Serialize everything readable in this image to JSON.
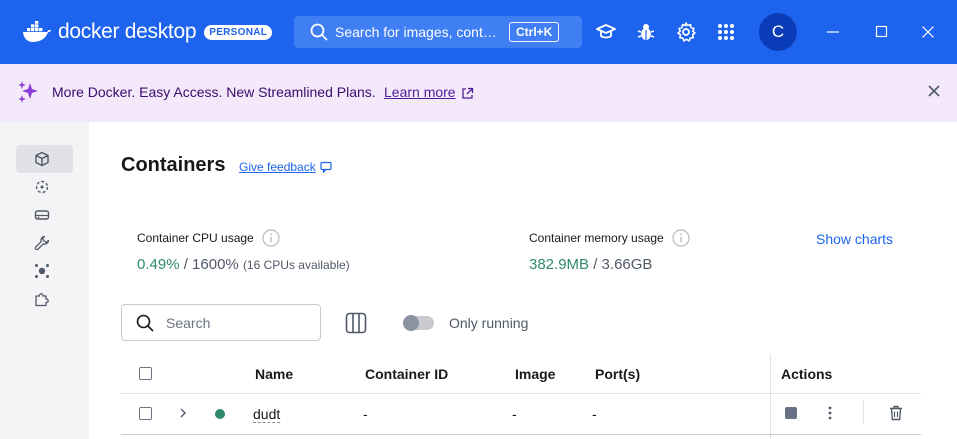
{
  "titlebar": {
    "logo_text": "docker desktop",
    "plan_badge": "PERSONAL",
    "search_placeholder": "Search for images, containers, volumes, extensions and more...",
    "search_shortcut": "Ctrl+K",
    "avatar_initial": "C"
  },
  "banner": {
    "message": "More Docker. Easy Access. New Streamlined Plans.",
    "link": "Learn more"
  },
  "sidebar": {
    "items": [
      "Containers",
      "Images",
      "Volumes",
      "Builds",
      "Docker Scout",
      "Extensions"
    ],
    "active": "Containers"
  },
  "page": {
    "title": "Containers",
    "feedback_link": "Give feedback"
  },
  "stats": {
    "cpu_label": "Container CPU usage",
    "cpu_value": "0.49%",
    "cpu_total": "/ 1600%",
    "cpu_note": "(16 CPUs available)",
    "mem_label": "Container memory usage",
    "mem_value": "382.9MB",
    "mem_total": "/ 3.66GB",
    "show_charts": "Show charts"
  },
  "toolbar": {
    "search_placeholder": "Search",
    "only_running_label": "Only running",
    "only_running": false
  },
  "table": {
    "columns": [
      "Name",
      "Container ID",
      "Image",
      "Port(s)",
      "Actions"
    ],
    "rows": [
      {
        "name": "dudt",
        "container_id": "-",
        "image": "-",
        "ports": "-",
        "status_color": "#2f8a6b"
      }
    ]
  },
  "colors": {
    "brand_blue": "#1d63ed",
    "banner_bg": "#f3e9fb",
    "running_green": "#2f8a6b"
  }
}
